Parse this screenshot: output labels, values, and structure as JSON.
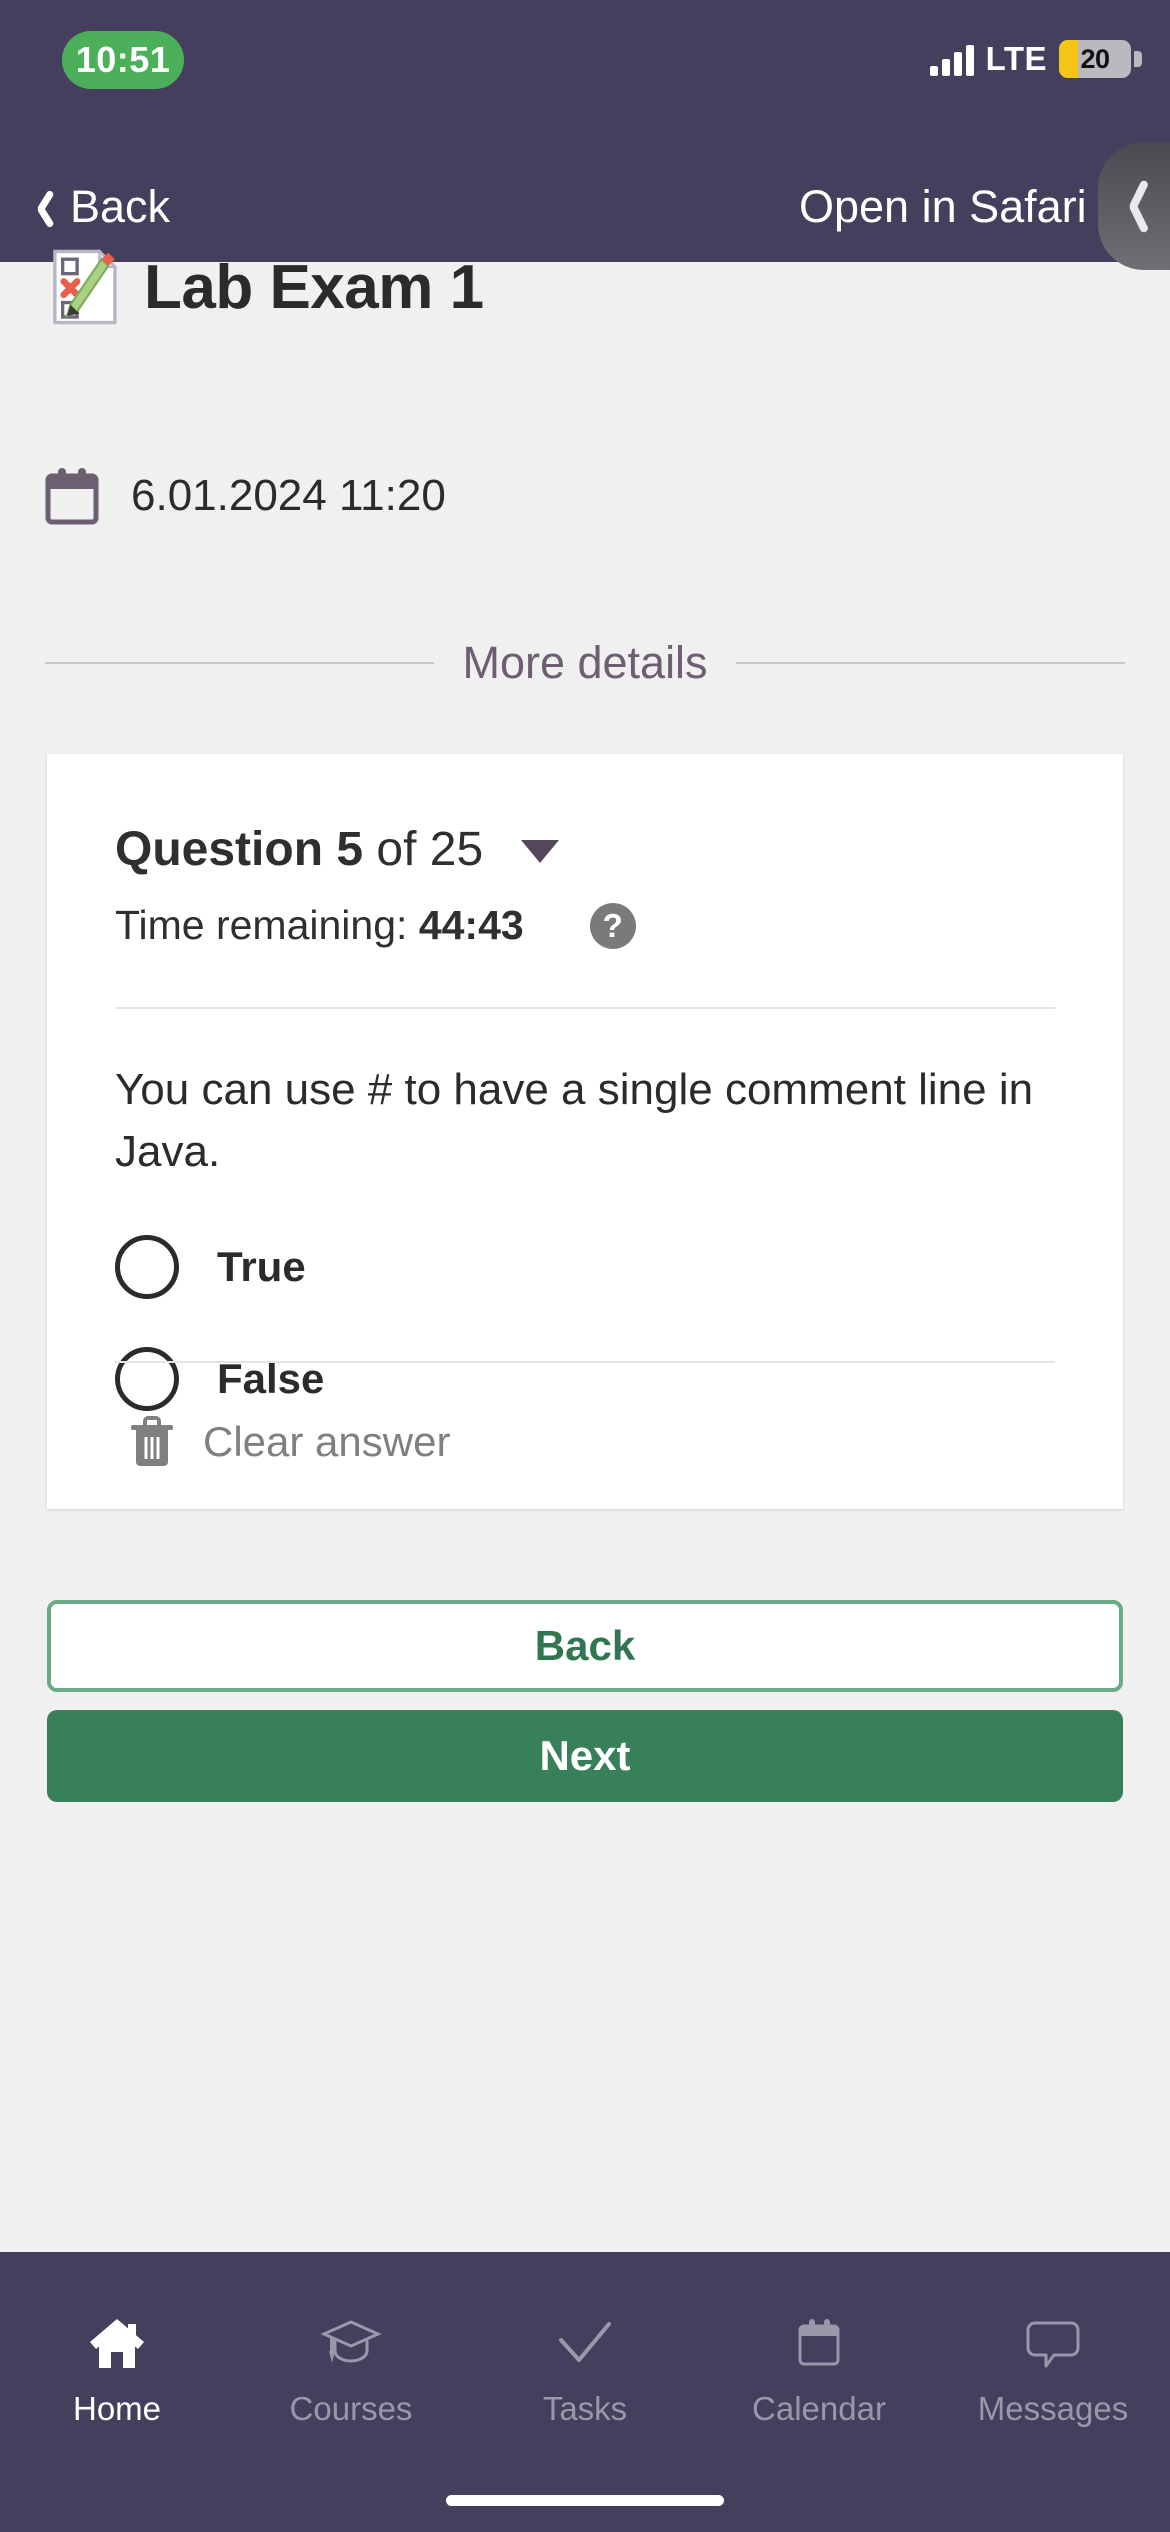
{
  "status_bar": {
    "time": "10:51",
    "network_type": "LTE",
    "battery_level": "20",
    "time_pill_color": "#4cb05b",
    "battery_fill_color": "#f5c518"
  },
  "nav_bar": {
    "back_label": "Back",
    "open_in_browser_label": "Open in Safari",
    "background_color": "#443f5c"
  },
  "drawer_handle": {
    "icon": "chevron-left-icon"
  },
  "header": {
    "title": "Lab Exam 1",
    "title_icon": "exam-clipboard-pencil-icon",
    "date_icon": "calendar-icon",
    "date": "6.01.2024 11:20",
    "more_details_label": "More details",
    "more_details_color": "#6d5e72"
  },
  "question_card": {
    "question_prefix": "Question",
    "question_number": "5",
    "question_of": "of",
    "question_total": "25",
    "dropdown_icon": "caret-down-icon",
    "time_remaining_label": "Time remaining:",
    "time_remaining_value": "44:43",
    "help_icon": "question-mark-circle-icon",
    "help_icon_glyph": "?",
    "question_text": "You can use # to have a single comment line in Java.",
    "options": [
      {
        "label": "True",
        "selected": false
      },
      {
        "label": "False",
        "selected": false
      }
    ],
    "clear_answer_label": "Clear answer",
    "clear_answer_icon": "trash-icon"
  },
  "actions": {
    "back_label": "Back",
    "next_label": "Next",
    "back_border_color": "#6aab87",
    "back_text_color": "#317551",
    "next_background_color": "#38805a"
  },
  "tab_bar": {
    "background_color": "#443f5c",
    "active_color": "#ffffff",
    "inactive_color": "#9b97a8",
    "tabs": [
      {
        "label": "Home",
        "icon": "home-icon",
        "active": true
      },
      {
        "label": "Courses",
        "icon": "graduation-cap-icon",
        "active": false
      },
      {
        "label": "Tasks",
        "icon": "checkmark-icon",
        "active": false
      },
      {
        "label": "Calendar",
        "icon": "calendar-icon",
        "active": false
      },
      {
        "label": "Messages",
        "icon": "speech-bubble-icon",
        "active": false
      }
    ]
  }
}
